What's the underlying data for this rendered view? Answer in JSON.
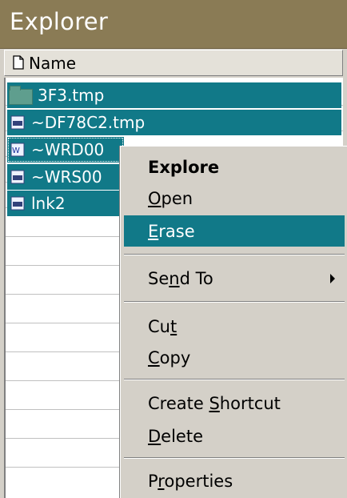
{
  "window": {
    "title": "Explorer"
  },
  "header": {
    "name_label": "Name"
  },
  "files": [
    {
      "name": "3F3.tmp",
      "icon": "folder-icon"
    },
    {
      "name": "~DF78C2.tmp",
      "icon": "file-icon"
    },
    {
      "name": "~WRD00",
      "icon": "word-doc-icon"
    },
    {
      "name": "~WRS00",
      "icon": "file-icon"
    },
    {
      "name": "lnk2",
      "icon": "file-icon"
    }
  ],
  "context_menu": {
    "explore": {
      "pre": "",
      "key": "",
      "post": "Explore"
    },
    "open": {
      "pre": "",
      "key": "O",
      "post": "pen"
    },
    "erase": {
      "pre": "",
      "key": "E",
      "post": "rase"
    },
    "send_to": {
      "pre": "Se",
      "key": "n",
      "post": "d To"
    },
    "cut": {
      "pre": "Cu",
      "key": "t",
      "post": ""
    },
    "copy": {
      "pre": "",
      "key": "C",
      "post": "opy"
    },
    "create_shortcut": {
      "pre": "Create ",
      "key": "S",
      "post": "hortcut"
    },
    "delete": {
      "pre": "",
      "key": "D",
      "post": "elete"
    },
    "properties": {
      "pre": "P",
      "key": "r",
      "post": "operties"
    }
  },
  "colors": {
    "selection": "#117988",
    "titlebar": "#8a7b55",
    "menu_bg": "#d4d0c8"
  }
}
